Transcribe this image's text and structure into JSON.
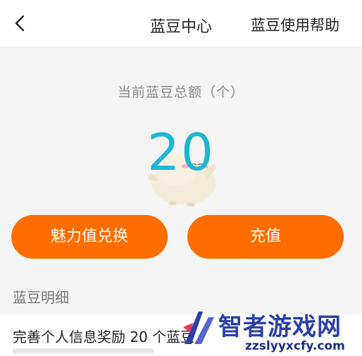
{
  "header": {
    "back_icon": "chevron-left-icon",
    "title": "蓝豆中心",
    "help_label": "蓝豆使用帮助"
  },
  "balance": {
    "label": "当前蓝豆总额（个）",
    "value": "20",
    "value_color": "#1fb6d4",
    "mascot_icon": "bird-mascot-icon"
  },
  "actions": {
    "exchange_label": "魅力值兑换",
    "recharge_label": "充值",
    "button_color": "#ff6d00"
  },
  "details": {
    "section_title": "蓝豆明细",
    "records": [
      {
        "title": "完善个人信息奖励 20 个蓝豆"
      }
    ]
  },
  "watermark": {
    "site_name": "智者游戏网",
    "url": "zzslyyxcfy.com"
  }
}
